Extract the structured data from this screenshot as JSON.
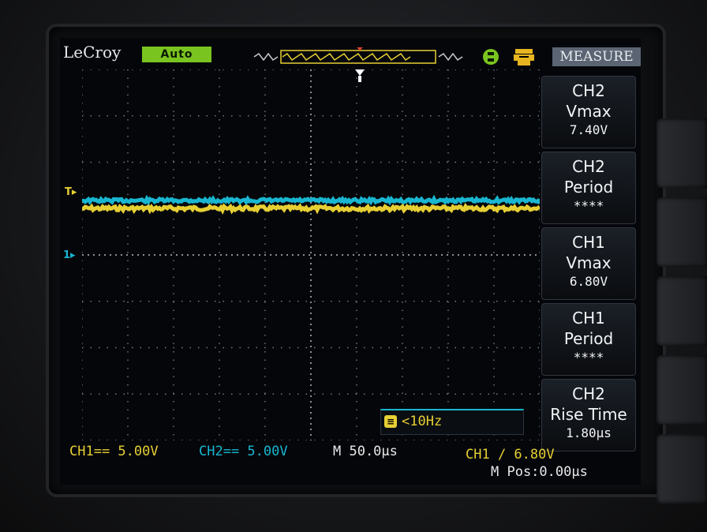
{
  "header": {
    "brand": "LeCroy",
    "trigger_mode": "Auto",
    "menu_title": "MEASURE"
  },
  "markers": {
    "ch1_level": "T",
    "ch1_ground": "1",
    "trigger_position": "T"
  },
  "frequency_readout": "<10Hz",
  "measure_menu": [
    {
      "line1": "CH2",
      "line2": "Vmax",
      "value": "7.40V"
    },
    {
      "line1": "CH2",
      "line2": "Period",
      "value": "****"
    },
    {
      "line1": "CH1",
      "line2": "Vmax",
      "value": "6.80V"
    },
    {
      "line1": "CH1",
      "line2": "Period",
      "value": "****"
    },
    {
      "line1": "CH2",
      "line2": "Rise Time",
      "value": "1.80µs"
    }
  ],
  "status": {
    "ch1_scale": "CH1== 5.00V",
    "ch2_scale": "CH2== 5.00V",
    "timebase": "M 50.0µs",
    "trigger": "CH1 ∕ 6.80V",
    "m_pos": "M Pos:0.00µs"
  },
  "colors": {
    "ch1": "#e6cf33",
    "ch2": "#19b6d1",
    "grid": "#8a8f96",
    "auto_badge": "#7ac41f",
    "screen_bg": "#04060a"
  }
}
